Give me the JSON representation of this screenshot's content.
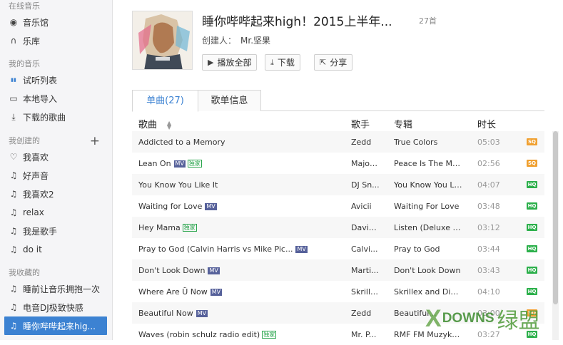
{
  "sidebar": {
    "sections": [
      {
        "title": "在线音乐",
        "items": [
          {
            "label": "音乐馆",
            "icon": "disc-icon"
          },
          {
            "label": "乐库",
            "icon": "headphones-icon"
          }
        ]
      },
      {
        "title": "我的音乐",
        "items": [
          {
            "label": "试听列表",
            "icon": "bars-icon"
          },
          {
            "label": "本地导入",
            "icon": "monitor-icon"
          },
          {
            "label": "下载的歌曲",
            "icon": "download-icon"
          }
        ]
      },
      {
        "title": "我创建的",
        "plus": "+",
        "items": [
          {
            "label": "我喜欢",
            "icon": "heart-icon"
          },
          {
            "label": "好声音",
            "icon": "music-note-icon"
          },
          {
            "label": "我喜欢2",
            "icon": "music-note-icon"
          },
          {
            "label": "relax",
            "icon": "music-note-icon"
          },
          {
            "label": "我是歌手",
            "icon": "music-note-icon"
          },
          {
            "label": "do it",
            "icon": "music-note-icon"
          }
        ]
      },
      {
        "title": "我收藏的",
        "items": [
          {
            "label": "睡前让音乐拥抱一次",
            "icon": "music-note-icon"
          },
          {
            "label": "电音DJ极致快感",
            "icon": "music-note-icon"
          },
          {
            "label": "睡你哔哔起来hig...",
            "icon": "music-note-icon",
            "active": true
          }
        ]
      }
    ]
  },
  "header": {
    "title": "睡你哔哔起来high！2015上半年...",
    "count": "27首",
    "creator_label": "创建人：",
    "creator_name": "Mr.坚果",
    "buttons": {
      "play_all": "播放全部",
      "download": "下载",
      "share": "分享"
    }
  },
  "tabs": [
    {
      "label": "单曲(27)",
      "active": true
    },
    {
      "label": "歌单信息",
      "active": false
    }
  ],
  "columns": {
    "song": "歌曲",
    "artist": "歌手",
    "album": "专辑",
    "duration": "时长"
  },
  "colors": {
    "accent": "#3c82d2",
    "sq": "#f0a030",
    "hq": "#2cb04b",
    "mv": "#56619a"
  },
  "rows": [
    {
      "song": "Addicted to a Memory",
      "mv": "",
      "dj": "",
      "artist": "Zedd",
      "album": "True Colors",
      "time": "05:03",
      "quality": "SQ"
    },
    {
      "song": "Lean On",
      "mv": "MV",
      "dj": "独家",
      "artist": "Major...",
      "album": "Peace Is The Mis...",
      "time": "02:56",
      "quality": "SQ"
    },
    {
      "song": "You Know You Like It",
      "mv": "",
      "dj": "",
      "artist": "DJ Sn...",
      "album": "You Know You Lik...",
      "time": "04:07",
      "quality": "HQ"
    },
    {
      "song": "Waiting for Love",
      "mv": "MV",
      "dj": "",
      "artist": "Avicii",
      "album": "Waiting For Love",
      "time": "03:48",
      "quality": "HQ"
    },
    {
      "song": "Hey Mama",
      "mv": "",
      "dj": "独家",
      "artist": "David...",
      "album": "Listen (Deluxe Ve...",
      "time": "03:12",
      "quality": "HQ"
    },
    {
      "song": "Pray to God (Calvin Harris vs Mike Pic...",
      "mv": "MV",
      "dj": "",
      "artist": "Calvi...",
      "album": "Pray to God",
      "time": "03:44",
      "quality": "HQ"
    },
    {
      "song": "Don't Look Down",
      "mv": "MV",
      "dj": "",
      "artist": "Marti...",
      "album": "Don't Look Down",
      "time": "03:43",
      "quality": "HQ"
    },
    {
      "song": "Where Are Ü Now",
      "mv": "MV",
      "dj": "",
      "artist": "Skrillex",
      "album": "Skrillex and Diplo ...",
      "time": "04:10",
      "quality": "HQ"
    },
    {
      "song": "Beautiful Now",
      "mv": "MV",
      "dj": "",
      "artist": "Zedd",
      "album": "Beautiful...",
      "time": "03:00",
      "quality": "SQ"
    },
    {
      "song": "Waves (robin schulz radio edit)",
      "mv": "",
      "dj": "独家",
      "artist": "Mr. P...",
      "album": "RMF FM Muzyka ...",
      "time": "03:27",
      "quality": "HQ"
    }
  ],
  "watermark": {
    "x": "X",
    "d": "DOWNS",
    "cn": "绿盟"
  }
}
